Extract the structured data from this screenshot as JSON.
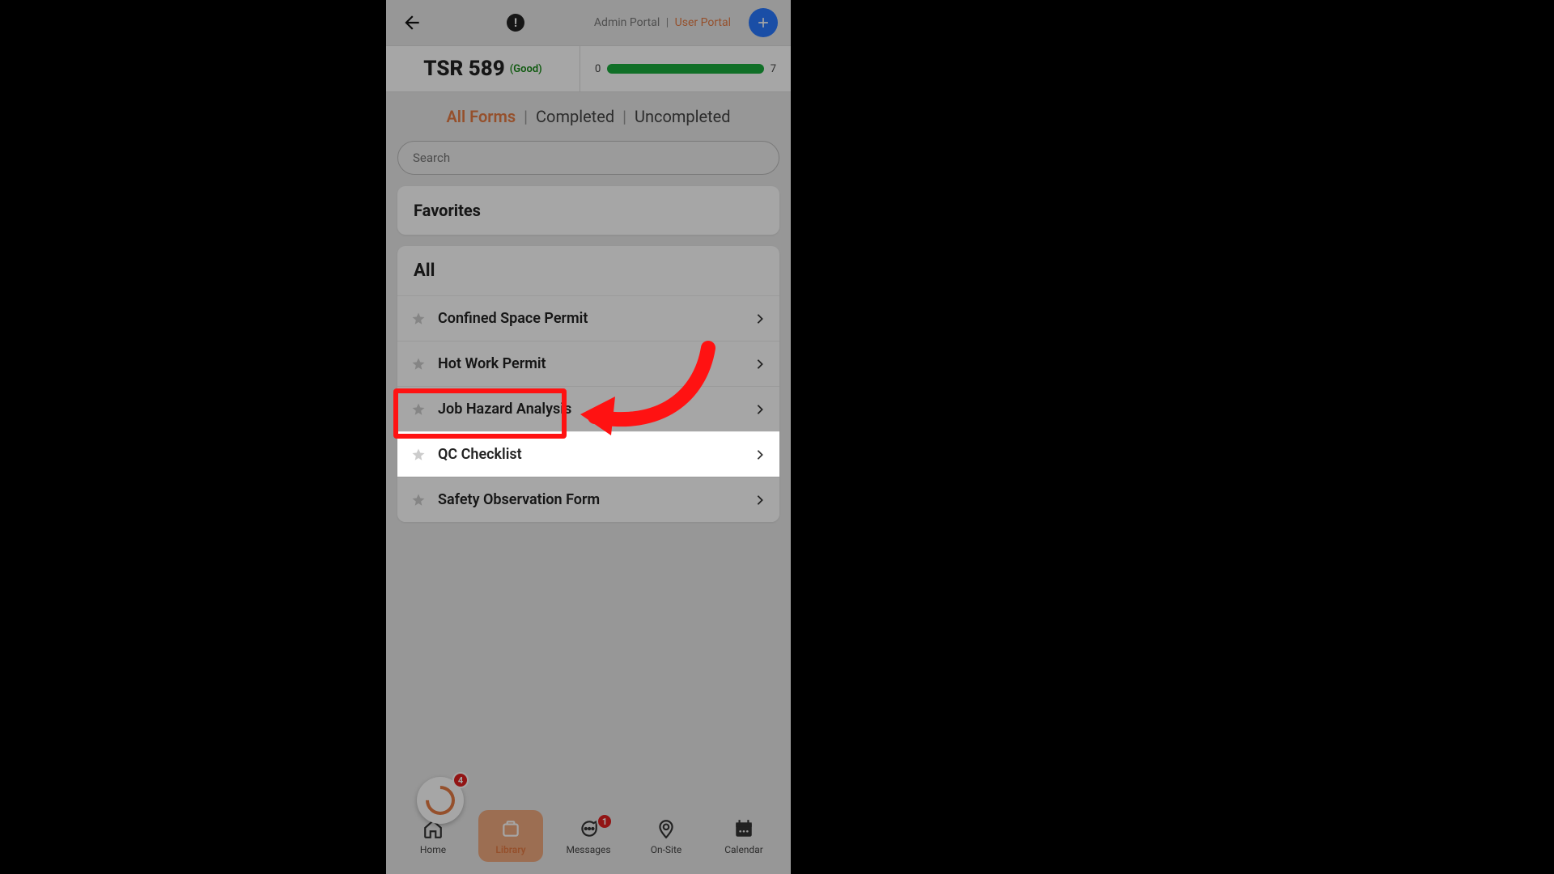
{
  "topbar": {
    "admin_portal": "Admin Portal",
    "user_portal": "User Portal",
    "divider": "|",
    "alert_glyph": "!"
  },
  "summary": {
    "title": "TSR 589",
    "status": "(Good)",
    "progress_min": "0",
    "progress_max": "7"
  },
  "tabs": {
    "all": "All Forms",
    "completed": "Completed",
    "uncompleted": "Uncompleted"
  },
  "search": {
    "placeholder": "Search"
  },
  "sections": {
    "favorites_header": "Favorites",
    "all_header": "All"
  },
  "forms": [
    {
      "label": "Confined Space Permit"
    },
    {
      "label": "Hot Work Permit"
    },
    {
      "label": "Job Hazard Analysis"
    },
    {
      "label": "QC Checklist"
    },
    {
      "label": "Safety Observation Form"
    }
  ],
  "nav": {
    "home": "Home",
    "library": "Library",
    "messages": "Messages",
    "onsite": "On-Site",
    "calendar": "Calendar",
    "fab_badge": "4",
    "messages_badge": "1"
  },
  "accent_color": "#e57b44"
}
